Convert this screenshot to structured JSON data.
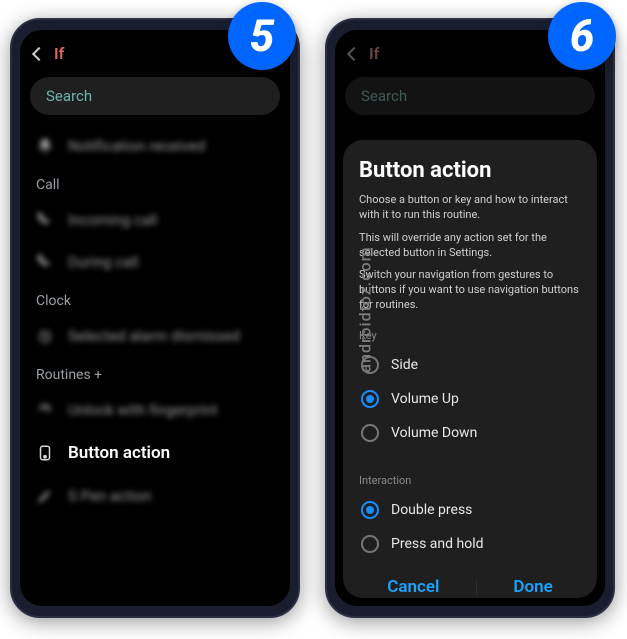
{
  "badges": {
    "left": "5",
    "right": "6"
  },
  "watermark": "androidtoz.com",
  "left": {
    "header": "If",
    "search_placeholder": "Search",
    "sections": {
      "s0_item": "Notification received",
      "s1_label": "Call",
      "s1_items": [
        "Incoming call",
        "During call"
      ],
      "s2_label": "Clock",
      "s2_items": [
        "Selected alarm dismissed"
      ],
      "s3_label": "Routines +",
      "s3_items_blur": [
        "Unlock with fingerprint",
        "S Pen action"
      ],
      "s3_item_highlight": "Button action"
    }
  },
  "right": {
    "header": "If",
    "search_placeholder": "Search",
    "modal": {
      "title": "Button action",
      "desc1": "Choose a button or key and how to interact with it to run this routine.",
      "desc2": "This will override any action set for the selected button in Settings.",
      "desc3": "Switch your navigation from gestures to buttons if you want to use navigation buttons for routines.",
      "key_label": "Key",
      "keys": [
        "Side",
        "Volume Up",
        "Volume Down"
      ],
      "key_selected": "Volume Up",
      "interaction_label": "Interaction",
      "interactions": [
        "Double press",
        "Press and hold"
      ],
      "interaction_selected": "Double press",
      "cancel": "Cancel",
      "done": "Done"
    }
  }
}
